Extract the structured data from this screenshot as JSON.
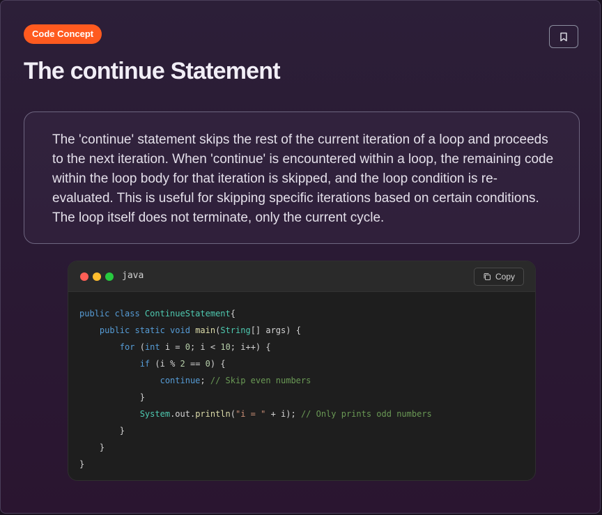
{
  "badge": "Code Concept",
  "title": "The continue Statement",
  "description": "The 'continue' statement skips the rest of the current iteration of a loop and proceeds to the next iteration. When 'continue' is encountered within a loop, the remaining code within the loop body for that iteration is skipped, and the loop condition is re-evaluated. This is useful for skipping specific iterations based on certain conditions. The loop itself does not terminate, only the current cycle.",
  "code": {
    "language": "java",
    "copy_label": "Copy",
    "lines": [
      [
        [
          "kw",
          "public class "
        ],
        [
          "ty",
          "ContinueStatement"
        ],
        [
          "",
          "{"
        ]
      ],
      [
        [
          "",
          "    "
        ],
        [
          "kw",
          "public static void "
        ],
        [
          "fn",
          "main"
        ],
        [
          "",
          "("
        ],
        [
          "ty",
          "String"
        ],
        [
          "",
          "[] args) {"
        ]
      ],
      [
        [
          "",
          "        "
        ],
        [
          "ctl",
          "for "
        ],
        [
          "",
          "("
        ],
        [
          "kw",
          "int"
        ],
        [
          "",
          " i = "
        ],
        [
          "num",
          "0"
        ],
        [
          "",
          "; i < "
        ],
        [
          "num",
          "10"
        ],
        [
          "",
          "; i++) {"
        ]
      ],
      [
        [
          "",
          "            "
        ],
        [
          "ctl",
          "if "
        ],
        [
          "",
          "(i % "
        ],
        [
          "num",
          "2"
        ],
        [
          "",
          " == "
        ],
        [
          "num",
          "0"
        ],
        [
          "",
          ") {"
        ]
      ],
      [
        [
          "",
          "                "
        ],
        [
          "ctl",
          "continue"
        ],
        [
          "",
          "; "
        ],
        [
          "cm",
          "// Skip even numbers"
        ]
      ],
      [
        [
          "",
          "            }"
        ]
      ],
      [
        [
          "",
          "            "
        ],
        [
          "ty",
          "System"
        ],
        [
          "",
          ".out."
        ],
        [
          "fn",
          "println"
        ],
        [
          "",
          "("
        ],
        [
          "str",
          "\"i = \""
        ],
        [
          "",
          " + i); "
        ],
        [
          "cm",
          "// Only prints odd numbers"
        ]
      ],
      [
        [
          "",
          "        }"
        ]
      ],
      [
        [
          "",
          "    }"
        ]
      ],
      [
        [
          "",
          "}"
        ]
      ]
    ]
  },
  "icons": {
    "bookmark": "bookmark-icon",
    "copy": "copy-icon"
  }
}
